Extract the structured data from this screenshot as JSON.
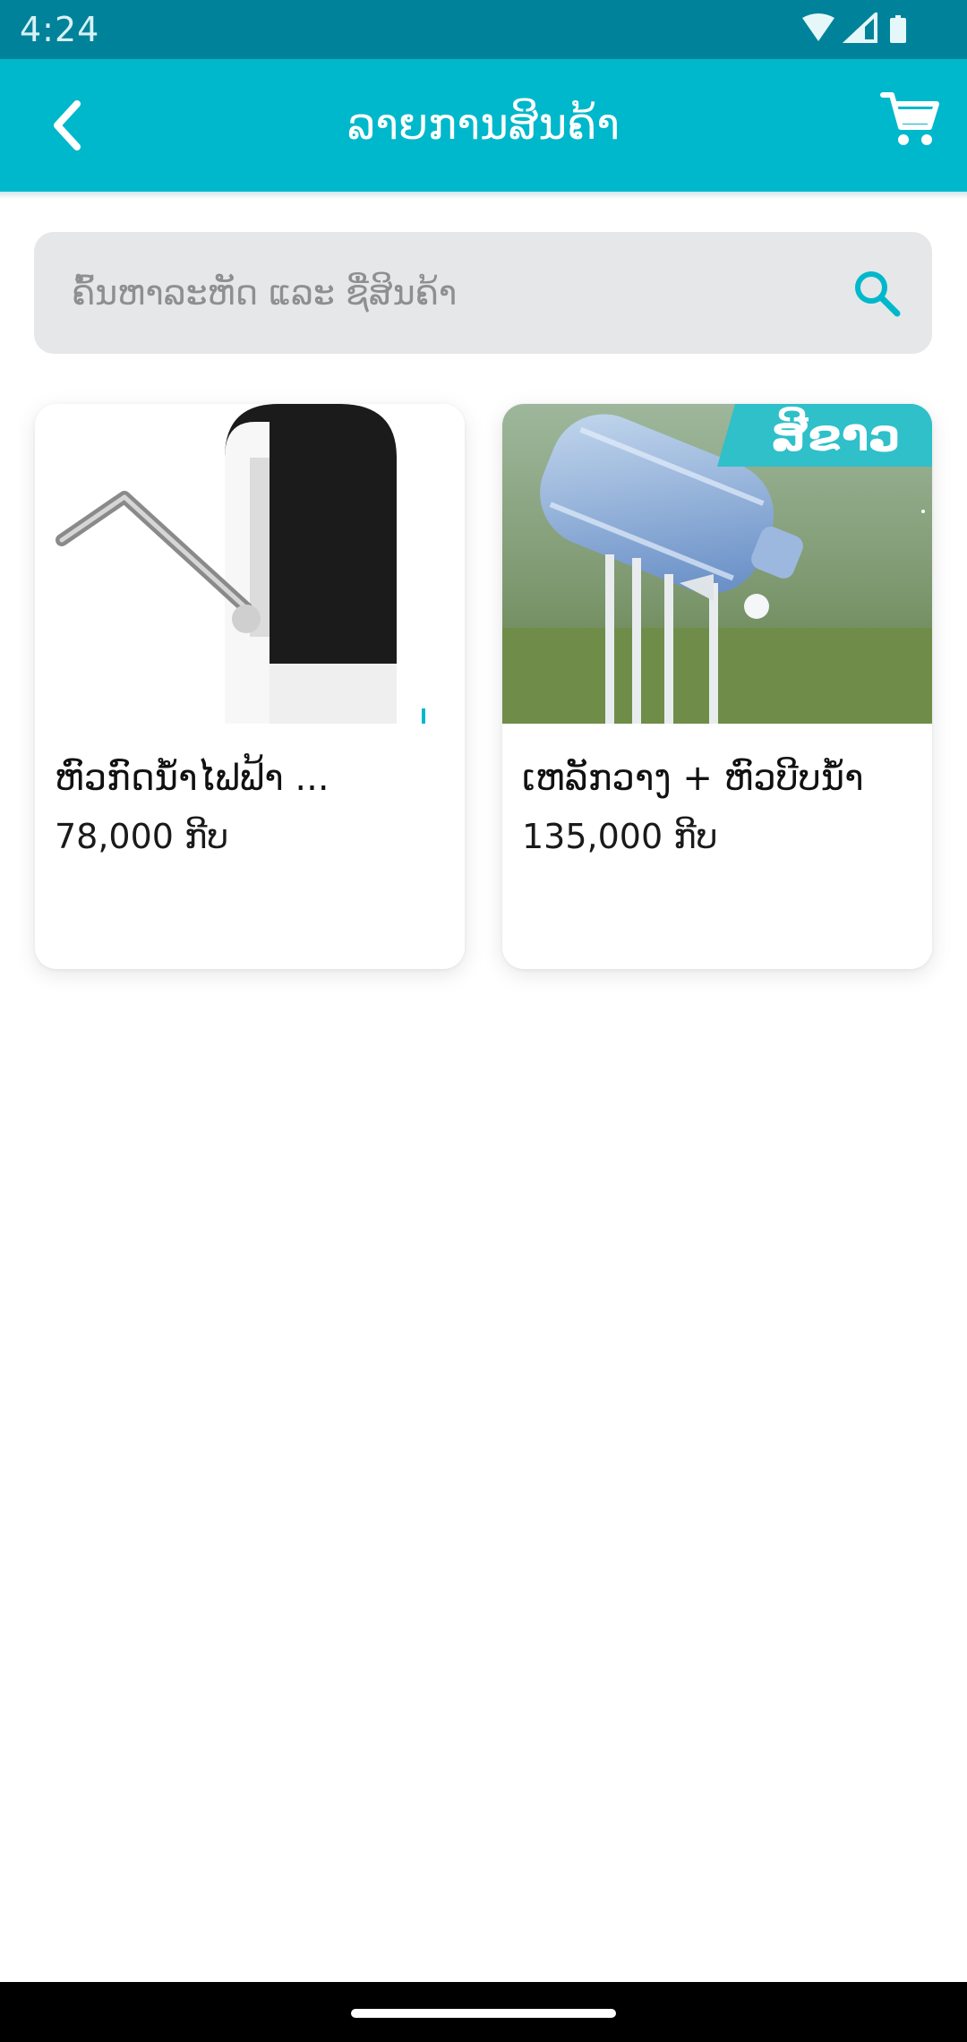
{
  "status_bar": {
    "time": "4:24",
    "icons": [
      "wifi-icon",
      "signal-icon",
      "battery-icon"
    ]
  },
  "app_bar": {
    "title": "ລາຍການສິນຄ້າ",
    "back_icon": "chevron-left-icon",
    "cart_icon": "cart-icon",
    "color": "#00b8cb"
  },
  "search": {
    "placeholder": "ຄົ້ນຫາລະຫັດ ແລະ ຊື່ສິນຄ້າ",
    "icon": "search-icon",
    "icon_color": "#00b8cb"
  },
  "products": [
    {
      "name": "ຫົວກົດນ້ຳໄຟຟ້າ ...",
      "price": "78,000 ກີບ",
      "image": "electric-water-pump-photo"
    },
    {
      "name": "ເຫລັກວາງ + ຫົວບີບນ້ຳ",
      "price": "135,000 ກີບ",
      "image": "water-bottle-stand-photo",
      "image_badge": "ສີຂາວ"
    }
  ],
  "colors": {
    "status_bar": "#00839a",
    "accent": "#00b8cb",
    "search_bg": "#e6e7e8"
  }
}
